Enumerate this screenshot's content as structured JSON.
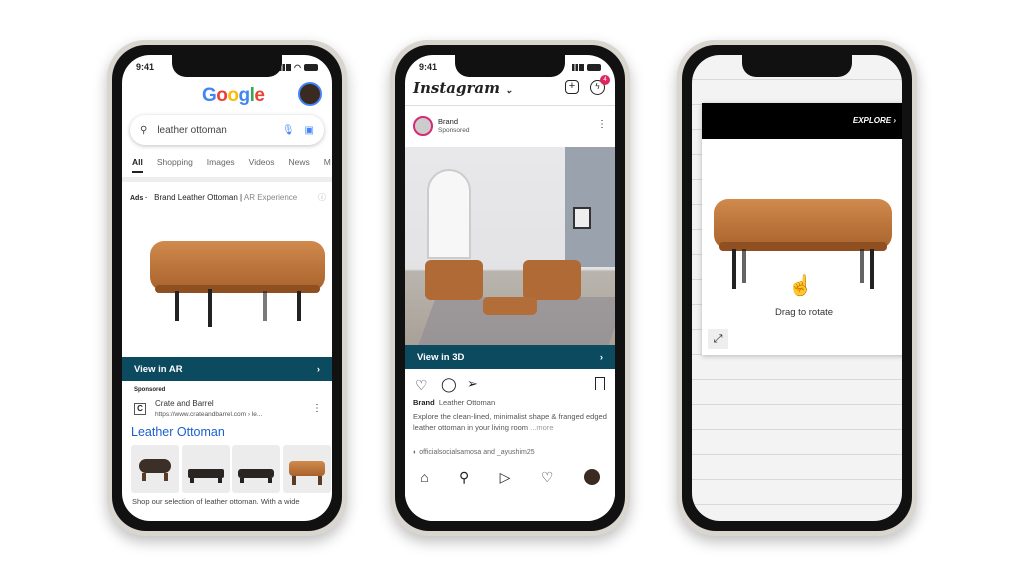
{
  "google": {
    "time": "9:41",
    "logo": "Google",
    "search_value": "leather ottoman",
    "tabs": [
      "All",
      "Shopping",
      "Images",
      "Videos",
      "News",
      "M"
    ],
    "ad_label": "Ads ·",
    "ad_title": "Brand Leather Ottoman",
    "ad_sep": " | ",
    "ad_subtitle": "AR Experience",
    "view_ar": "View in AR",
    "chevron": "›",
    "sponsored": "Sponsored",
    "advertiser_initial": "C",
    "advertiser": "Crate and Barrel",
    "url": "https://www.crateandbarrel.com › le...",
    "result_title": "Leather Ottoman",
    "snippet": "Shop our selection of leather ottoman. With a wide"
  },
  "instagram": {
    "time": "9:41",
    "logo": "Instagram",
    "notif_count": "4",
    "account": "Brand",
    "sponsored": "Sponsored",
    "view_3d": "View in 3D",
    "chevron": "›",
    "caption_user": "Brand",
    "caption_title": "Leather Ottoman",
    "caption_text": "Explore the clean-lined, minimalist shape & franged edged leather ottoman in your living room",
    "more": "...more",
    "comment_preview": "officialsocialsamosa and _ayushim25"
  },
  "ar_viewer": {
    "explore": "EXPLORE",
    "chevron": "›",
    "hint": "Drag to rotate"
  },
  "colors": {
    "ar_bar": "#0c4a60",
    "link_blue": "#1a5fd0",
    "leather": "#b8703a"
  }
}
